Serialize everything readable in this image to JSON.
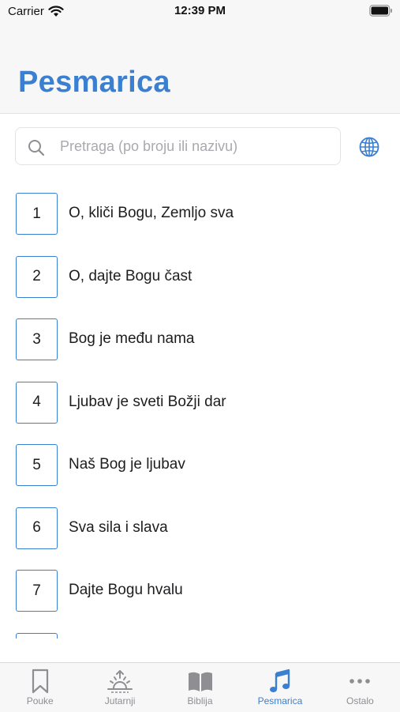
{
  "status_bar": {
    "carrier": "Carrier",
    "time": "12:39 PM"
  },
  "header": {
    "title": "Pesmarica"
  },
  "search": {
    "placeholder": "Pretraga (po broju ili nazivu)",
    "value": ""
  },
  "icons": {
    "search": "search-icon",
    "globe": "globe-icon"
  },
  "songs": [
    {
      "number": "1",
      "title": "O, kliči Bogu, Zemljo sva"
    },
    {
      "number": "2",
      "title": "O, dajte Bogu čast"
    },
    {
      "number": "3",
      "title": "Bog je među nama"
    },
    {
      "number": "4",
      "title": "Ljubav je sveti Božji dar"
    },
    {
      "number": "5",
      "title": "Naš Bog je ljubav"
    },
    {
      "number": "6",
      "title": "Sva sila i slava"
    },
    {
      "number": "7",
      "title": "Dajte Bogu hvalu"
    },
    {
      "number": "",
      "title": ""
    }
  ],
  "tabs": [
    {
      "label": "Pouke",
      "icon": "bookmark-icon",
      "active": false
    },
    {
      "label": "Jutarnji",
      "icon": "sunrise-icon",
      "active": false
    },
    {
      "label": "Biblija",
      "icon": "book-icon",
      "active": false
    },
    {
      "label": "Pesmarica",
      "icon": "music-note-icon",
      "active": true
    },
    {
      "label": "Ostalo",
      "icon": "ellipsis-icon",
      "active": false
    }
  ],
  "colors": {
    "accent": "#3a7fd0",
    "inactive": "#8e8e93",
    "bar_background": "#f7f7f8"
  }
}
